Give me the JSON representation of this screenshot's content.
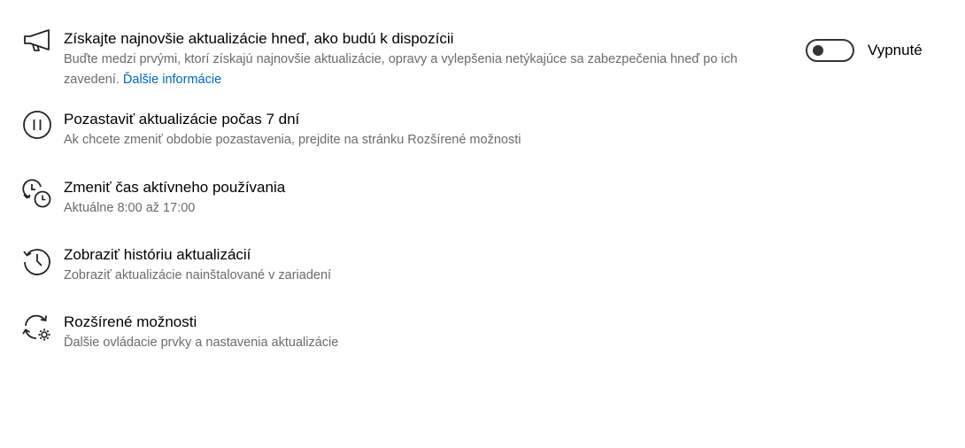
{
  "settings": {
    "updates_first": {
      "icon": "megaphone-icon",
      "title": "Získajte najnovšie aktualizácie hneď, ako budú k dispozícii",
      "description": "Buďte medzi prvými, ktorí získajú najnovšie aktualizácie, opravy a vylepšenia netýkajúce sa zabezpečenia hneď po ich zavedení.",
      "link": "Ďalšie informácie",
      "toggle_state_label": "Vypnuté",
      "toggle_on": false
    },
    "pause": {
      "icon": "pause-icon",
      "title": "Pozastaviť aktualizácie počas 7 dní",
      "description": "Ak chcete zmeniť obdobie pozastavenia, prejdite na stránku Rozšírené možnosti"
    },
    "active_hours": {
      "icon": "clock-sync-icon",
      "title": "Zmeniť čas aktívneho používania",
      "description": "Aktuálne 8:00 až 17:00"
    },
    "history": {
      "icon": "history-icon",
      "title": "Zobraziť históriu aktualizácií",
      "description": "Zobraziť aktualizácie nainštalované v zariadení"
    },
    "advanced": {
      "icon": "refresh-gear-icon",
      "title": "Rozšírené možnosti",
      "description": "Ďalšie ovládacie prvky a nastavenia aktualizácie"
    }
  },
  "colors": {
    "link": "#0067b8",
    "secondary_text": "#6b6b6b",
    "primary_text": "#000000",
    "toggle_off": "#333333"
  }
}
